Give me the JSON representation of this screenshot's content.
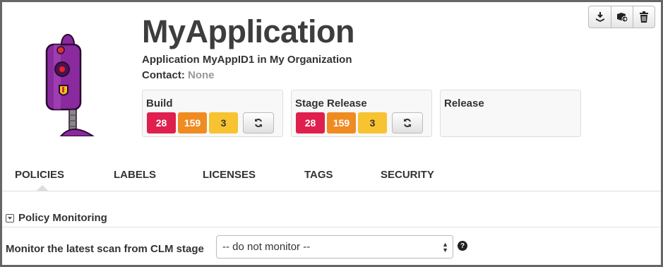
{
  "toolbar": {
    "buttons": [
      {
        "icon": "download-icon"
      },
      {
        "icon": "move-icon"
      },
      {
        "icon": "trash-icon"
      }
    ]
  },
  "app": {
    "title": "MyApplication",
    "subtitle": "Application MyAppID1 in My Organization",
    "contact_label": "Contact:",
    "contact_value": "None"
  },
  "stages": [
    {
      "title": "Build",
      "critical": "28",
      "severe": "159",
      "moderate": "3"
    },
    {
      "title": "Stage Release",
      "critical": "28",
      "severe": "159",
      "moderate": "3"
    },
    {
      "title": "Release"
    }
  ],
  "tabs": [
    {
      "label": "POLICIES",
      "active": true
    },
    {
      "label": "LABELS"
    },
    {
      "label": "LICENSES"
    },
    {
      "label": "TAGS"
    },
    {
      "label": "SECURITY"
    }
  ],
  "policy": {
    "section_title": "Policy Monitoring",
    "monitor_label": "Monitor the latest scan from CLM stage",
    "monitor_value": "-- do not monitor --",
    "help_glyph": "?"
  },
  "colors": {
    "critical": "#df1f4e",
    "severe": "#f08b22",
    "moderate": "#f7c331",
    "avatar_purple": "#8a2a9e"
  }
}
